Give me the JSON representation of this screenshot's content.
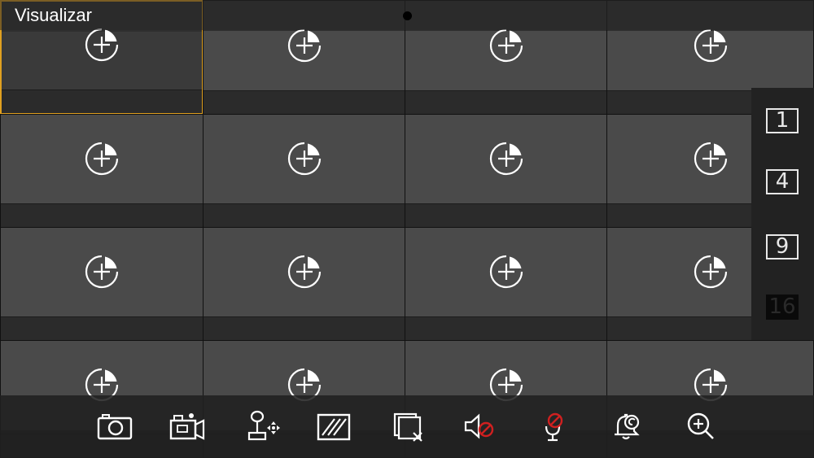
{
  "header": {
    "title": "Visualizar"
  },
  "grid": {
    "rows": 4,
    "columns": 4,
    "selected_index": 0,
    "channels": [
      {
        "action": "add-channel"
      },
      {
        "action": "add-channel"
      },
      {
        "action": "add-channel"
      },
      {
        "action": "add-channel"
      },
      {
        "action": "add-channel"
      },
      {
        "action": "add-channel"
      },
      {
        "action": "add-channel"
      },
      {
        "action": "add-channel"
      },
      {
        "action": "add-channel"
      },
      {
        "action": "add-channel"
      },
      {
        "action": "add-channel"
      },
      {
        "action": "add-channel"
      },
      {
        "action": "add-channel"
      },
      {
        "action": "add-channel"
      },
      {
        "action": "add-channel"
      },
      {
        "action": "add-channel"
      }
    ]
  },
  "layout_panel": {
    "options": [
      {
        "label": "1",
        "active": false
      },
      {
        "label": "4",
        "active": false
      },
      {
        "label": "9",
        "active": false
      },
      {
        "label": "16",
        "active": true
      }
    ]
  },
  "toolbar": {
    "tools": [
      {
        "icon": "camera-icon",
        "action": "snapshot"
      },
      {
        "icon": "video-record-icon",
        "action": "record"
      },
      {
        "icon": "ptz-joystick-icon",
        "action": "ptz"
      },
      {
        "icon": "image-quality-icon",
        "action": "quality"
      },
      {
        "icon": "close-all-icon",
        "action": "close-all"
      },
      {
        "icon": "audio-muted-icon",
        "action": "audio"
      },
      {
        "icon": "microphone-muted-icon",
        "action": "talk"
      },
      {
        "icon": "alarm-icon",
        "action": "alarm"
      },
      {
        "icon": "zoom-in-icon",
        "action": "zoom"
      }
    ]
  },
  "colors": {
    "accent": "#e0a020",
    "muted_red": "#d02020",
    "icon": "#ffffff"
  }
}
